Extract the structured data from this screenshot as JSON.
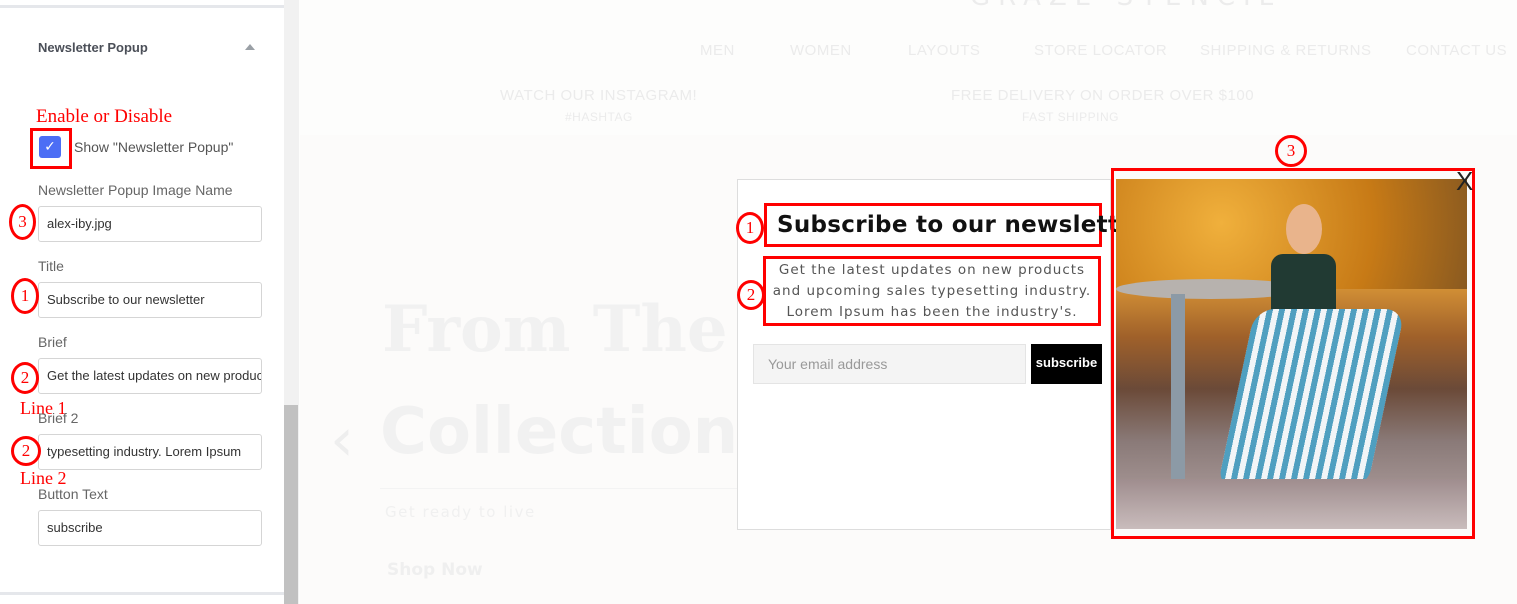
{
  "sidebar": {
    "section_title": "Newsletter Popup",
    "show_popup": {
      "label": "Show \"Newsletter Popup\"",
      "checked": true
    },
    "fields": [
      {
        "label": "Newsletter Popup Image Name",
        "value": "alex-iby.jpg"
      },
      {
        "label": "Title",
        "value": "Subscribe to our newsletter"
      },
      {
        "label": "Brief",
        "value": "Get the latest updates on new products"
      },
      {
        "label": "Brief 2",
        "value": " typesetting industry. Lorem Ipsum"
      },
      {
        "label": "Button Text",
        "value": "subscribe"
      }
    ]
  },
  "annotations": {
    "enable": "Enable or Disable",
    "n1": "1",
    "n2": "2",
    "n3": "3",
    "line1": "Line 1",
    "line2": "Line 2"
  },
  "site": {
    "logo": "GRAZE-STENCIL",
    "nav": [
      "MEN",
      "WOMEN",
      "LAYOUTS",
      "STORE LOCATOR",
      "SHIPPING & RETURNS",
      "CONTACT US"
    ],
    "promos": [
      {
        "title": "WATCH OUR INSTAGRAM!",
        "sub": "#HASHTAG"
      },
      {
        "title": "FREE DELIVERY ON ORDER OVER $100",
        "sub": "FAST SHIPPING"
      }
    ],
    "hero": {
      "line1": "From The",
      "line2": "Collection",
      "sub": "Get ready to live",
      "cta": "Shop Now"
    }
  },
  "popup": {
    "title": "Subscribe to our newsletter",
    "brief_lines": [
      "Get the latest updates on new products",
      "and upcoming sales typesetting industry.",
      "Lorem Ipsum has been the industry's."
    ],
    "email_placeholder": "Your email address",
    "button": "subscribe",
    "close": "X"
  },
  "colors": {
    "accent": "#4c6ef5",
    "annotation": "#ff0000"
  }
}
